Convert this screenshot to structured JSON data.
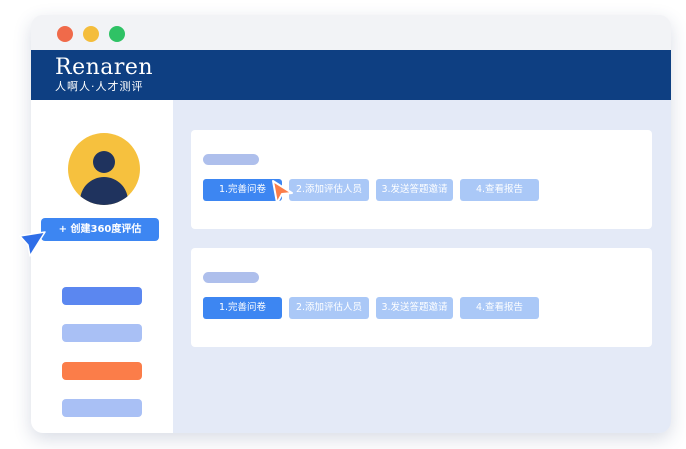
{
  "window": {
    "controls": [
      "close",
      "minimize",
      "maximize"
    ]
  },
  "brand": {
    "name": "Renaren",
    "tagline": "人啊人·人才测评"
  },
  "sidebar": {
    "create_button": "+ 创建360度评估",
    "nav_item_colors": [
      "#5b87f0",
      "#a9c0f5",
      "#fb7d49",
      "#a9c0f5"
    ]
  },
  "cards": [
    {
      "steps": [
        "1.完善问卷",
        "2.添加评估人员",
        "3.发送答题邀请",
        "4.查看报告"
      ],
      "active_step": 1
    },
    {
      "steps": [
        "1.完善问卷",
        "2.添加评估人员",
        "3.发送答题邀请",
        "4.查看报告"
      ],
      "active_step": 1
    }
  ],
  "colors": {
    "header": "#0e3f82",
    "accent": "#3d86f2",
    "pending": "#aac8f7",
    "orange": "#fb7d49"
  },
  "icons": {
    "cursor_orange": "cursor-arrow-icon",
    "cursor_blue": "cursor-arrow-icon"
  }
}
